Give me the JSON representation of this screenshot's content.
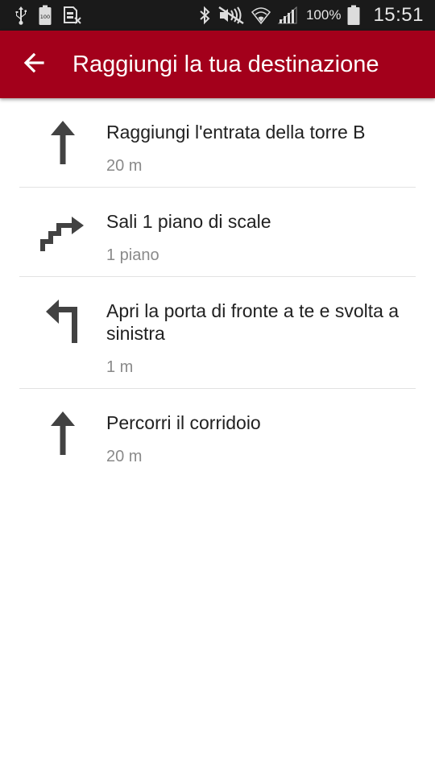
{
  "status_bar": {
    "icons": [
      "usb-icon",
      "battery-100-notification-icon",
      "sim-card-icon",
      "bluetooth-icon",
      "mute-icon",
      "wifi-icon",
      "signal-icon",
      "battery-icon"
    ],
    "battery_percent": "100%",
    "time": "15:51"
  },
  "app_bar": {
    "title": "Raggiungi la tua destinazione",
    "back_icon": "arrow-back-icon",
    "color": "#a3001b"
  },
  "steps": [
    {
      "icon": "arrow-straight-icon",
      "title": "Raggiungi l'entrata della torre B",
      "detail": "20 m"
    },
    {
      "icon": "stairs-up-icon",
      "title": "Sali 1 piano di scale",
      "detail": "1 piano"
    },
    {
      "icon": "turn-left-icon",
      "title": "Apri la porta di fronte a te e svolta a sinistra",
      "detail": "1 m"
    },
    {
      "icon": "arrow-straight-icon",
      "title": "Percorri il corridoio",
      "detail": "20 m"
    }
  ]
}
